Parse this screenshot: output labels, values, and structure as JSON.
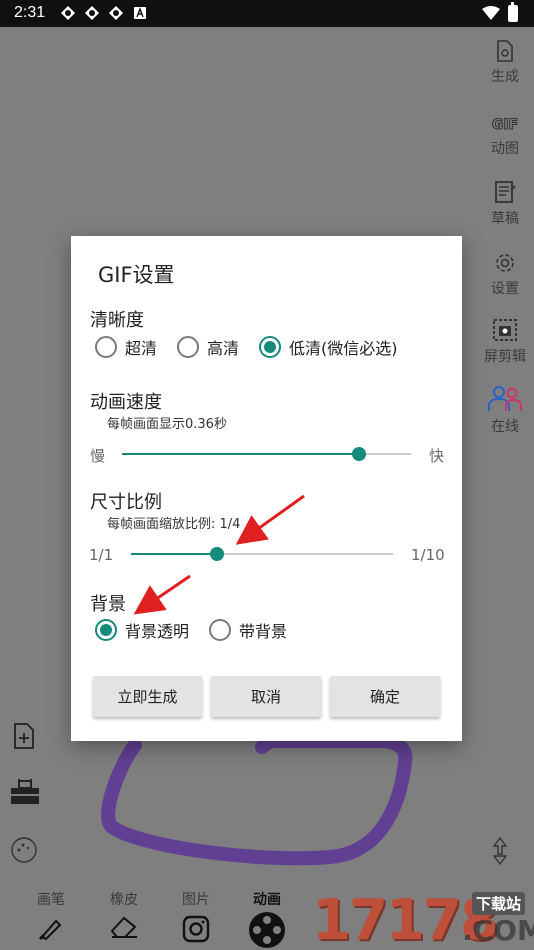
{
  "status_bar": {
    "time": "2:31"
  },
  "right_toolbar": {
    "items": [
      {
        "label": "生成",
        "icon": "file-gen-icon"
      },
      {
        "label": "动图",
        "icon": "gif-icon",
        "icon_text": "GIF"
      },
      {
        "label": "草稿",
        "icon": "draft-icon"
      },
      {
        "label": "设置",
        "icon": "gear-icon"
      },
      {
        "label": "屏剪辑",
        "icon": "screen-clip-icon"
      },
      {
        "label": "在线",
        "icon": "users-online-icon"
      }
    ]
  },
  "bottom_toolbar": {
    "items": [
      {
        "label": "画笔",
        "icon": "brush-icon"
      },
      {
        "label": "橡皮",
        "icon": "eraser-icon"
      },
      {
        "label": "图片",
        "icon": "image-icon"
      },
      {
        "label": "动画",
        "icon": "animation-icon",
        "active": true
      }
    ]
  },
  "watermark": {
    "number": "17178",
    "suffix": ".COM",
    "site": "下载站"
  },
  "dialog": {
    "title": "GIF设置",
    "clarity": {
      "title": "清晰度",
      "options": [
        "超清",
        "高清",
        "低清(微信必选)"
      ],
      "selected_index": 2
    },
    "speed": {
      "title": "动画速度",
      "subtitle": "每帧画面显示0.36秒",
      "min_label": "慢",
      "max_label": "快",
      "value_fraction": 0.82
    },
    "scale": {
      "title": "尺寸比例",
      "subtitle": "每帧画面缩放比例: 1/4",
      "min_label": "1/1",
      "max_label": "1/10",
      "value_fraction": 0.33
    },
    "background": {
      "title": "背景",
      "options": [
        "背景透明",
        "带背景"
      ],
      "selected_index": 0
    },
    "buttons": {
      "generate": "立即生成",
      "cancel": "取消",
      "confirm": "确定"
    }
  },
  "colors": {
    "accent": "#168a7b",
    "annotation_arrow": "#e02020",
    "stroke": "#6a3aa8"
  }
}
